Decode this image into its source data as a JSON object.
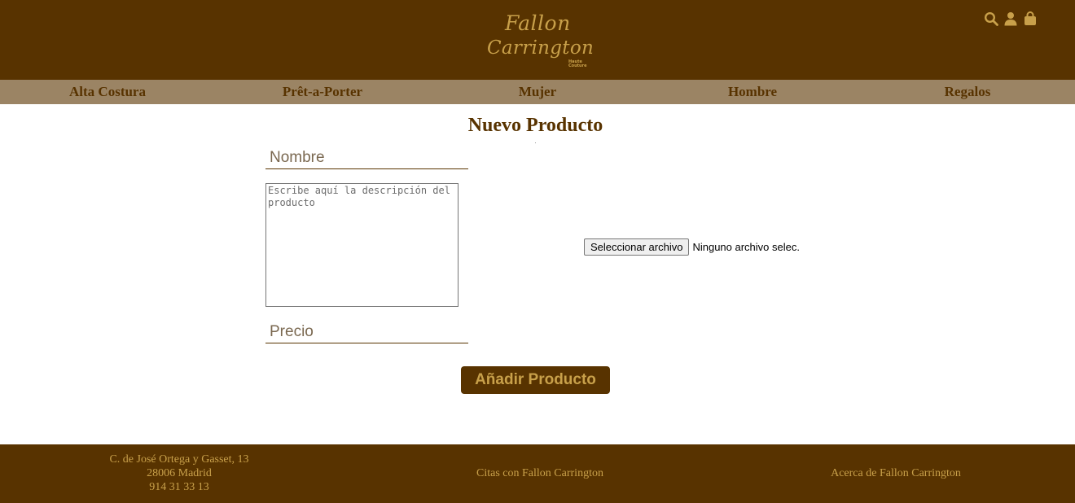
{
  "header": {
    "logo": {
      "line1": "Fallon",
      "line2": "Carrington",
      "tag1": "Haute",
      "tag2": "Couture"
    },
    "icons": [
      "search-icon",
      "user-icon",
      "shopping-bag-icon"
    ],
    "colors": {
      "brand": "#583300",
      "accent": "#c8a04a",
      "nav_bg": "#9b8464"
    }
  },
  "nav": {
    "items": [
      "Alta Costura",
      "Prêt-a-Porter",
      "Mujer",
      "Hombre",
      "Regalos"
    ]
  },
  "form": {
    "title": "Nuevo Producto",
    "name_placeholder": "Nombre",
    "description_placeholder": "Escribe aquí la descripción del producto",
    "price_placeholder": "Precio",
    "file_button": "Seleccionar archivo",
    "file_status": "Ninguno archivo selec.",
    "submit_label": "Añadir Producto"
  },
  "footer": {
    "address_line1": "C. de José Ortega y Gasset, 13",
    "address_line2": "28006 Madrid",
    "phone": "914 31 33 13",
    "link_appointments": "Citas con Fallon Carrington",
    "link_about": "Acerca de Fallon Carrington"
  }
}
